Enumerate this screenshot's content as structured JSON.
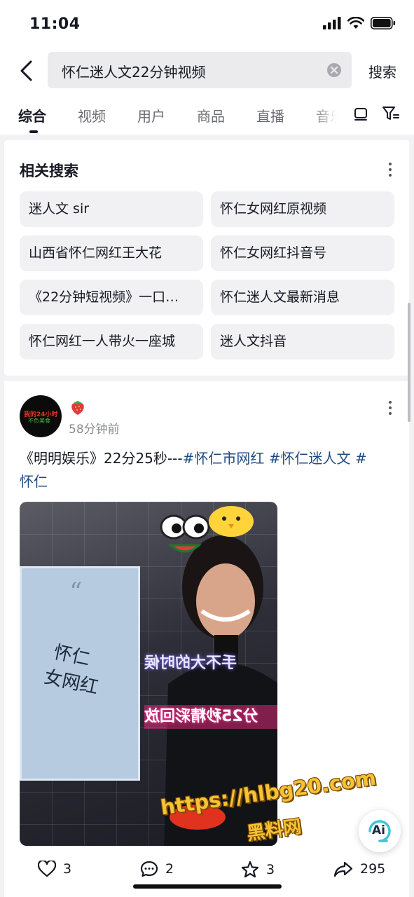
{
  "status_bar": {
    "time": "11:04"
  },
  "search": {
    "query": "怀仁迷人文22分钟视频",
    "submit_label": "搜索"
  },
  "tabs": [
    {
      "label": "综合",
      "active": true
    },
    {
      "label": "视频"
    },
    {
      "label": "用户"
    },
    {
      "label": "商品"
    },
    {
      "label": "直播"
    },
    {
      "label": "音乐"
    }
  ],
  "related": {
    "title": "相关搜索",
    "items": [
      "迷人文 sir",
      "怀仁女网红原视频",
      "山西省怀仁网红王大花",
      "怀仁女网红抖音号",
      "《22分钟短视频》一口…",
      "怀仁迷人文最新消息",
      "怀仁网红一人带火一座城",
      "迷人文抖音"
    ]
  },
  "post": {
    "avatar_text_1": "我的24小时",
    "avatar_text_2": "不负美食",
    "author_emoji": "🍓",
    "time": "58分钟前",
    "caption_prefix": "《明明娱乐》22分25秒---",
    "hashtags": [
      "#怀仁市网红",
      "#怀仁迷人文",
      "#",
      "怀仁"
    ],
    "video": {
      "doc_text_1": "怀仁",
      "doc_text_2": "女网红",
      "banner_1": "手不大的时候",
      "banner_2": "分25秒精彩回放",
      "watermark_1": "https://hlbg20.com",
      "watermark_2": "黑料网"
    },
    "actions": {
      "likes": "3",
      "comments": "2",
      "favorites": "3",
      "shares": "295"
    }
  },
  "ai_button": {
    "label": "Ai"
  },
  "colors": {
    "hashtag": "#1f4a80",
    "text": "#161823",
    "muted": "#8a8b91",
    "chip_bg": "#f1f1f3"
  }
}
